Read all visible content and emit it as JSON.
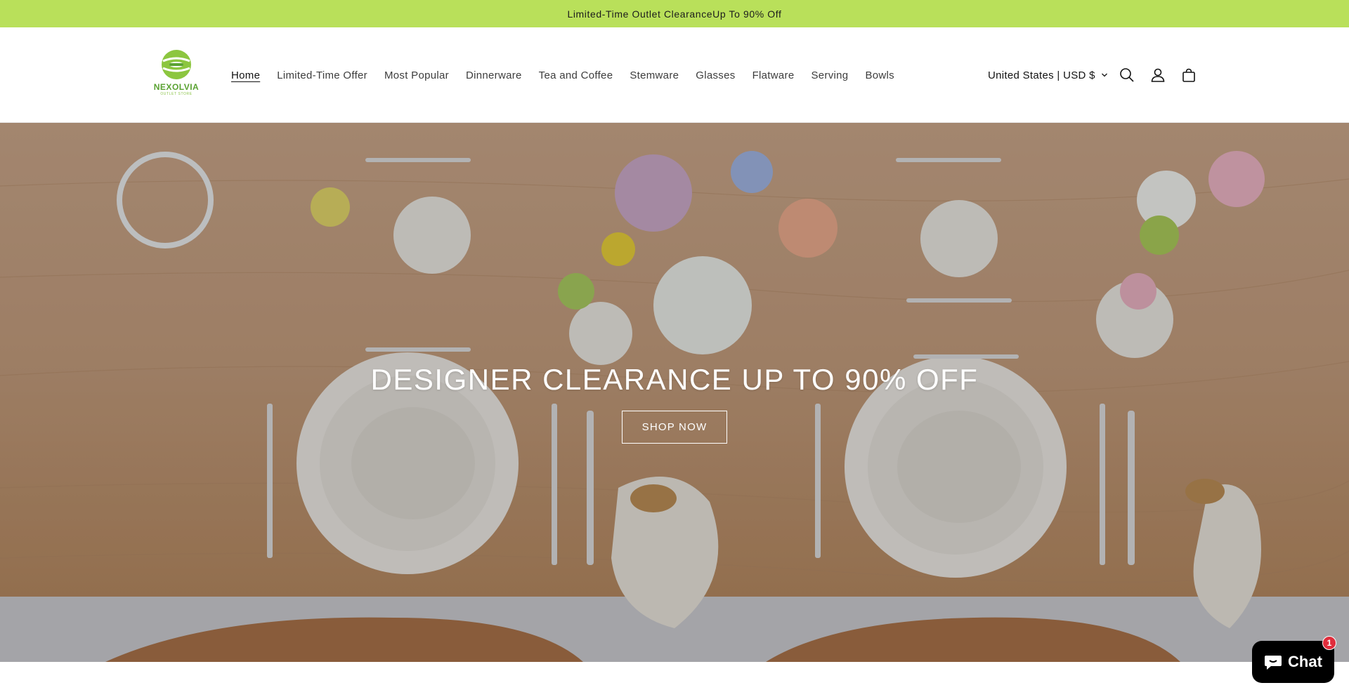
{
  "announcement": {
    "text": "Limited-Time Outlet ClearanceUp To 90% Off"
  },
  "brand": {
    "name": "NEXOLVIA",
    "tagline": "OUTLET STORE",
    "accent": "#b9e05a"
  },
  "nav": {
    "items": [
      {
        "label": "Home",
        "active": true
      },
      {
        "label": "Limited-Time Offer"
      },
      {
        "label": "Most Popular"
      },
      {
        "label": "Dinnerware"
      },
      {
        "label": "Tea and Coffee"
      },
      {
        "label": "Stemware"
      },
      {
        "label": "Glasses"
      },
      {
        "label": "Flatware"
      },
      {
        "label": "Serving"
      },
      {
        "label": "Bowls"
      }
    ]
  },
  "header": {
    "locale_label": "United States | USD $",
    "icons": [
      "search-icon",
      "account-icon",
      "cart-icon"
    ]
  },
  "hero": {
    "title": "DESIGNER CLEARANCE UP TO 90% OFF",
    "button_label": "SHOP NOW"
  },
  "chat": {
    "label": "Chat",
    "badge_count": "1",
    "badge_color": "#e02d3c"
  }
}
